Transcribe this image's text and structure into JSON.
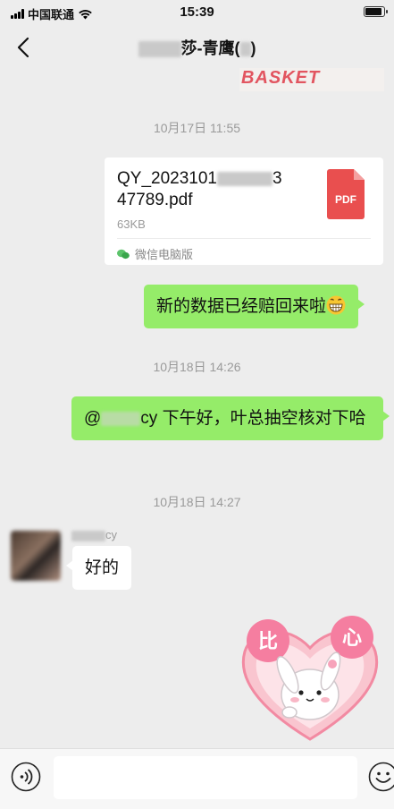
{
  "status_bar": {
    "carrier": "中国联通",
    "time": "15:39"
  },
  "nav": {
    "title_suffix": "莎-青鹰(",
    "title_end": ")"
  },
  "top_sticker_text": "BASKET",
  "messages": {
    "ts1": "10月17日 11:55",
    "file": {
      "name_line1_prefix": "QY_2023101",
      "name_line1_suffix": "3",
      "name_line2": "47789.pdf",
      "size": "63KB",
      "icon_label": "PDF",
      "source": "微信电脑版"
    },
    "msg1": "新的数据已经赔回来啦",
    "ts2": "10月18日 14:26",
    "msg2_prefix": "@",
    "msg2_suffix": "cy 下午好，叶总抽空核对下哈",
    "ts3": "10月18日 14:27",
    "sender_suffix": "cy",
    "msg3": "好的",
    "sticker": {
      "word1": "比",
      "word2": "心"
    }
  },
  "input": {
    "placeholder": ""
  },
  "colors": {
    "background": "#ededed",
    "my_bubble": "#95ec69",
    "pdf_red": "#e94f4f"
  }
}
